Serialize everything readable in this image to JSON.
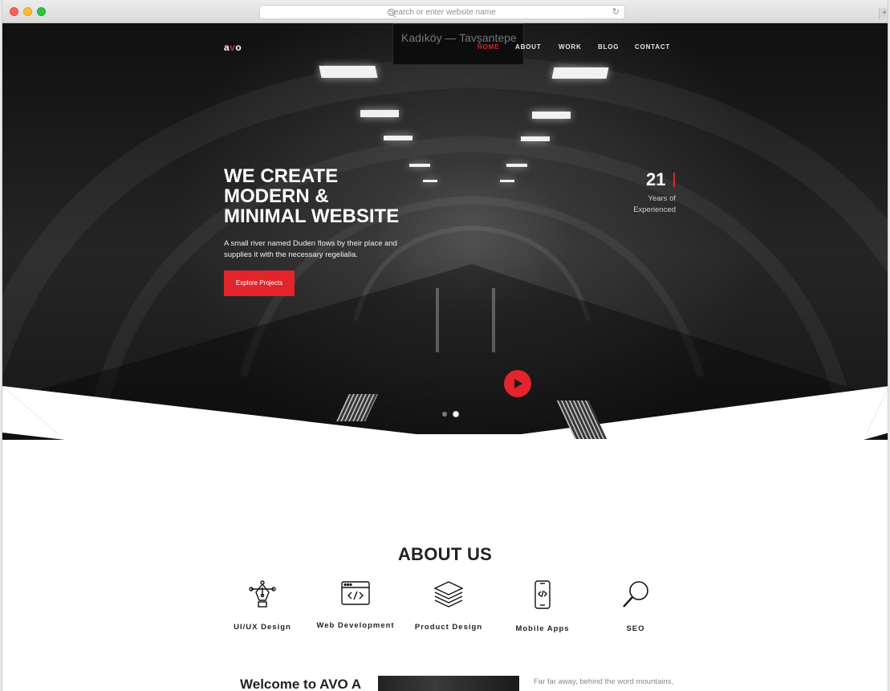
{
  "browser": {
    "url_placeholder": "Search or enter website name",
    "new_tab_glyph": "+"
  },
  "sign_text": "Kadıköy — Tavşantepe",
  "header": {
    "logo_part1": "a",
    "logo_accent": "v",
    "logo_part2": "o",
    "nav": [
      "HOME",
      "ABOUT",
      "WORK",
      "BLOG",
      "CONTACT"
    ],
    "active": "HOME"
  },
  "hero": {
    "title_lines": [
      "WE CREATE",
      "MODERN &",
      "MINIMAL WEBSITE"
    ],
    "subtitle": "A small river named Duden flows by their place and supplies it with the necessary regelialia.",
    "button": "Explore Projects",
    "stat_number": "21",
    "stat_label_1": "Years of",
    "stat_label_2": "Experienced",
    "slides": 2,
    "active_slide": 2
  },
  "about": {
    "title": "ABOUT US",
    "services": [
      {
        "label": "UI/UX Design",
        "icon": "pen-tool-icon"
      },
      {
        "label": "Web Development",
        "icon": "code-window-icon"
      },
      {
        "label": "Product Design",
        "icon": "layers-icon"
      },
      {
        "label": "Mobile Apps",
        "icon": "mobile-code-icon"
      },
      {
        "label": "SEO",
        "icon": "magnifier-icon"
      }
    ]
  },
  "welcome": {
    "heading": "Welcome to AVO A",
    "paragraph": "Far far away, behind the word mountains,"
  },
  "colors": {
    "accent": "#e3242b",
    "text_dark": "#222222"
  }
}
